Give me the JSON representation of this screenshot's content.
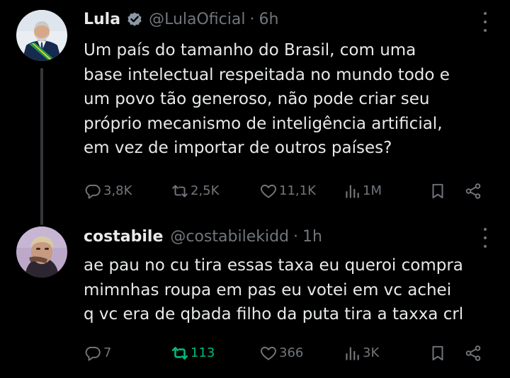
{
  "tweets": [
    {
      "display_name": "Lula",
      "verified": true,
      "handle": "@LulaOficial",
      "separator": "·",
      "time": "6h",
      "text_lines": [
        "Um país do tamanho do Brasil, com uma",
        "base intelectual respeitada no mundo todo e",
        "um povo tão generoso, não pode criar seu",
        "próprio mecanismo de inteligência artificial,",
        "em vez de importar de outros países?"
      ],
      "stats": {
        "replies": "3,8K",
        "retweets": "2,5K",
        "likes": "11,1K",
        "views": "1M"
      },
      "icons": [
        "more-icon",
        "reply-icon",
        "retweet-icon",
        "like-icon",
        "views-icon",
        "bookmark-icon",
        "share-icon",
        "verified-icon"
      ]
    },
    {
      "display_name": "costabile",
      "verified": false,
      "handle": "@costabilekidd",
      "separator": "·",
      "time": "1h",
      "text_lines": [
        "ae pau no cu tira essas taxa eu queroi compra",
        "mimnhas roupa em pas eu votei em vc achei",
        "q vc era de qbada filho da puta tira a taxxa crl"
      ],
      "stats": {
        "replies": "7",
        "retweets": "113",
        "likes": "366",
        "views": "3K"
      },
      "retweeted": true,
      "icons": [
        "more-icon",
        "reply-icon",
        "retweet-icon",
        "like-icon",
        "views-icon",
        "bookmark-icon",
        "share-icon"
      ]
    }
  ],
  "colors": {
    "background": "#000000",
    "text_primary": "#e7e9ea",
    "text_secondary": "#71767b",
    "verified_badge": "#8b98a5",
    "retweet_active": "#00ba7c",
    "thread_line": "#333639"
  }
}
